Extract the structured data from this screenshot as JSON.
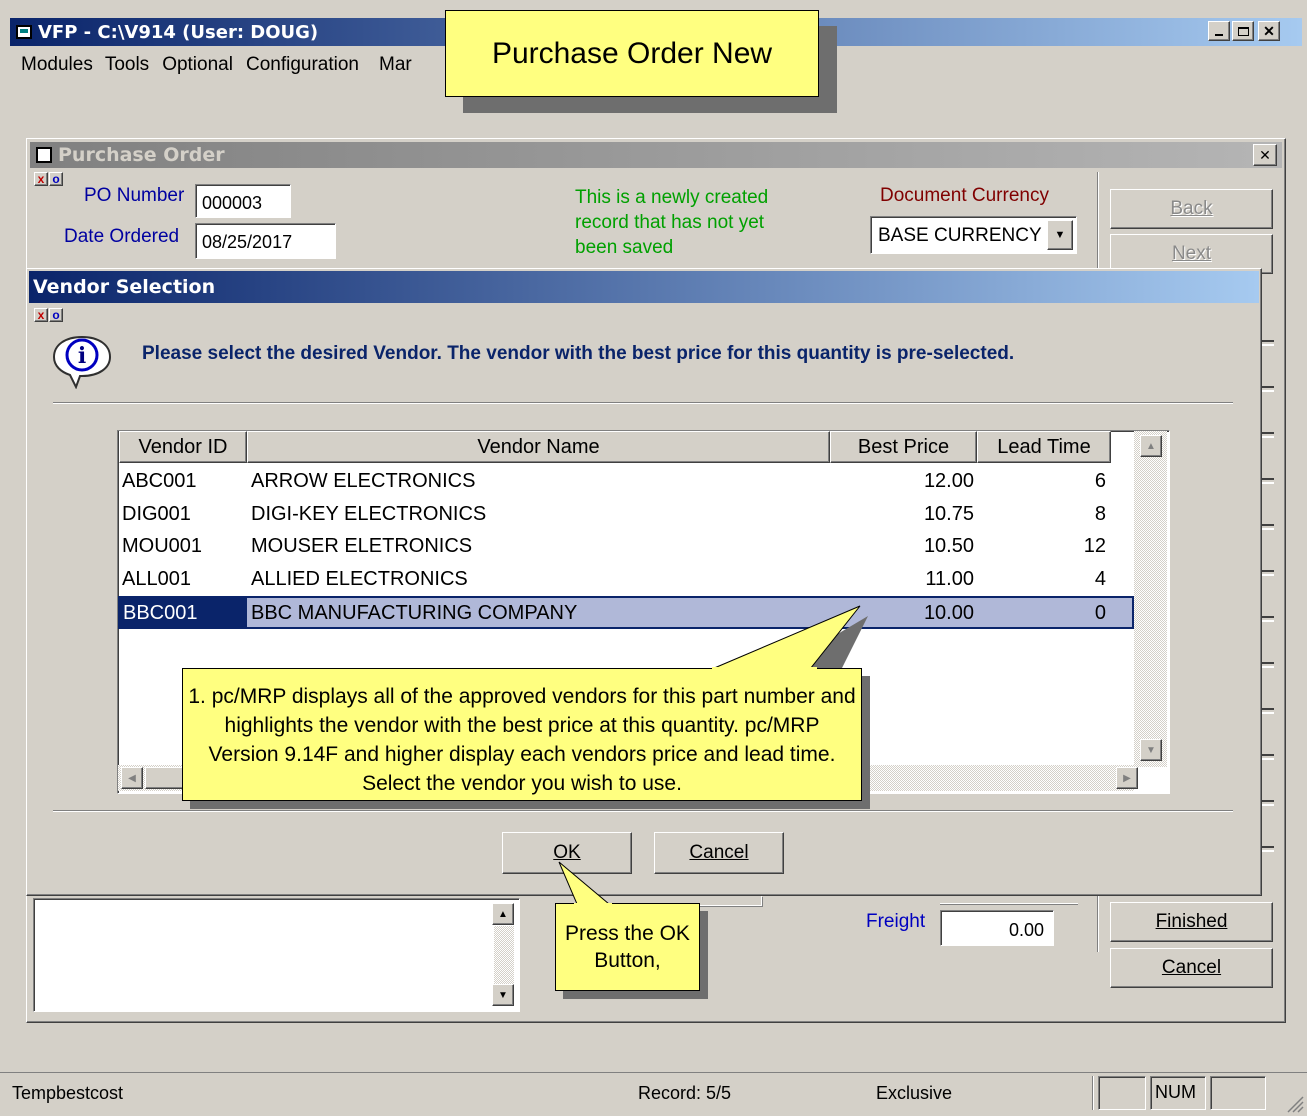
{
  "app": {
    "title": "VFP - C:\\V914  (User: DOUG)",
    "menu": [
      "Modules",
      "Tools",
      "Optional",
      "Configuration",
      "Mar"
    ]
  },
  "banner": {
    "text": "Purchase Order New"
  },
  "po_window": {
    "title": "Purchase Order",
    "po_number_label": "PO Number",
    "po_number_value": "000003",
    "date_ordered_label": "Date Ordered",
    "date_ordered_value": "08/25/2017",
    "new_record_notice": "This is a newly created record that has not yet been saved",
    "currency_label": "Document Currency",
    "currency_value": "BASE CURRENCY",
    "back_button": "Back",
    "next_button": "Next",
    "freight_label": "Freight",
    "freight_value": "0.00",
    "finished_button": "Finished",
    "cancel_button": "Cancel"
  },
  "vendor_dialog": {
    "title": "Vendor Selection",
    "message": "Please select the desired Vendor. The vendor with the best price for this quantity is pre-selected.",
    "columns": [
      "Vendor ID",
      "Vendor Name",
      "Best Price",
      "Lead Time"
    ],
    "rows": [
      {
        "id": "ABC001",
        "name": "ARROW ELECTRONICS",
        "price": "12.00",
        "lead": "6"
      },
      {
        "id": "DIG001",
        "name": "DIGI-KEY ELECTRONICS",
        "price": "10.75",
        "lead": "8"
      },
      {
        "id": "MOU001",
        "name": "MOUSER ELETRONICS",
        "price": "10.50",
        "lead": "12"
      },
      {
        "id": "ALL001",
        "name": "ALLIED ELECTRONICS",
        "price": "11.00",
        "lead": "4"
      },
      {
        "id": "BBC001",
        "name": "BBC MANUFACTURING COMPANY",
        "price": "10.00",
        "lead": "0",
        "selected": true
      }
    ],
    "ok_button": "OK",
    "cancel_button": "Cancel"
  },
  "callouts": {
    "vendor_note": "1. pc/MRP displays all of the approved vendors for this part number and highlights the vendor with the best price at this quantity.  pc/MRP Version 9.14F and higher display each vendors price and lead time.  Select the vendor you wish to use.",
    "ok_note": "Press the OK Button,"
  },
  "statusbar": {
    "left": "Tempbestcost",
    "record": "Record: 5/5",
    "mode": "Exclusive",
    "num": "NUM"
  },
  "colors": {
    "selection": "#b0b8d8",
    "notice_green": "#00a000",
    "currency_red": "#800000",
    "freight_blue": "#0000c0",
    "message_blue": "#0a246a",
    "callout_yellow": "#ffff80"
  }
}
